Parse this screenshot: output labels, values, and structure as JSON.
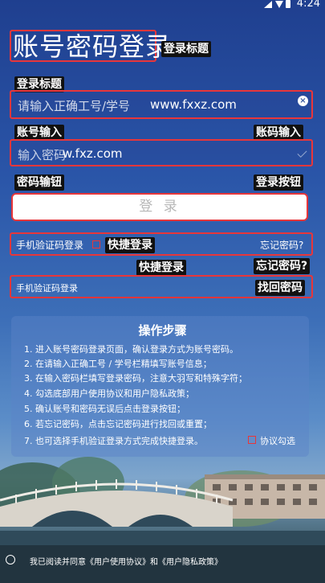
{
  "status": {
    "time": "4:24"
  },
  "title": "账号密码登录",
  "annotations": {
    "title_tag": "登录标题",
    "label_login_title": "登录标题",
    "label_account_input": "账号输入",
    "label_password_input": "账码输入",
    "label_password_button": "密码输钮",
    "label_login_button": "登录按钮",
    "label_quick_login": "快捷登录",
    "label_quick_login_2": "快捷登录",
    "label_forgot": "忘记密码?",
    "label_recover": "找回密码"
  },
  "account_field": {
    "placeholder": "请输入正确工号/学号",
    "watermark": "www.fxxz.com",
    "clear_icon": "clear-icon"
  },
  "password_field": {
    "placeholder": "输入密码",
    "watermark": "w.fxz.com"
  },
  "login_button": {
    "label": "登 录"
  },
  "row1": {
    "sms_login": "手机验证码登录",
    "forgot": "忘记密码?"
  },
  "row2": {
    "sms_login": "手机验证码登录"
  },
  "steps": {
    "title": "操作步骤",
    "items": [
      "1. 进入账号密码登录页面，确认登录方式为账号密码。",
      "2. 在请输入正确工号 / 学号栏精填写账号信息；",
      "3. 在输入密码栏填写登录密码，注意大羽写和特殊字符；",
      "4. 勾选底部用户使用协议和用户隐私政策；",
      "5. 确认账号和密码无误后点击登录按钮；",
      "6. 若忘记密码，点击忘记密码进行找回或重置；",
      "7. 也可选择手机验证登录方式完成快捷登录。"
    ],
    "agree_check": "协议勾选"
  },
  "agreement": "我已阅读并同意《用户使用协议》和《用户隐私政策》",
  "colors": {
    "annotation_red": "#e8363a",
    "primary_blue": "#2a55a8"
  }
}
